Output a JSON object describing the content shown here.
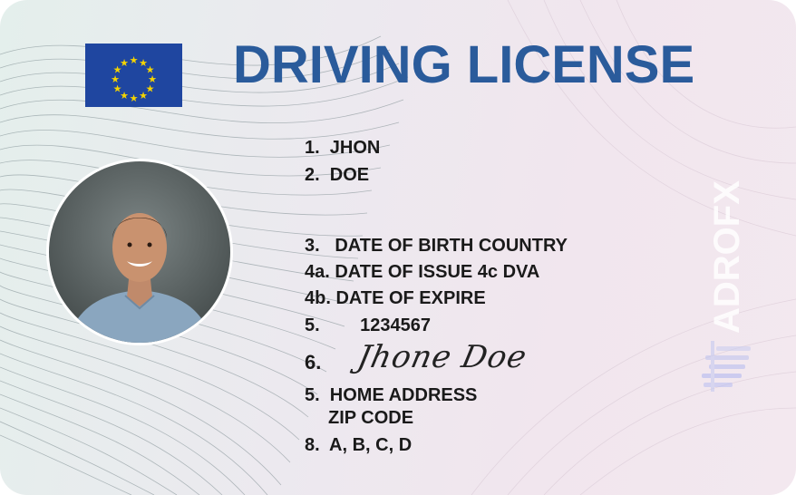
{
  "card": {
    "title": "DRIVING LICENSE",
    "flag_icon": "eu-flag-icon",
    "photo_icon": "portrait-photo-icon"
  },
  "fields": {
    "f1": "1.  JHON",
    "f2": "2.  DOE",
    "f3": "3.   DATE OF BIRTH COUNTRY",
    "f4a": "4a. DATE OF ISSUE 4c DVA",
    "f4b": "4b. DATE OF EXPIRE",
    "f5_number": "5.        1234567",
    "f6_label": "6.",
    "signature": "Jhone Doe",
    "f5_address": "5.  HOME ADDRESS",
    "zip": "ZIP CODE",
    "f8": "8.  A, B, C, D"
  },
  "watermark": {
    "text": "ADROFX",
    "icon": "adrofx-logo-icon"
  },
  "colors": {
    "title": "#2a5b9b",
    "flag": "#1f46a0",
    "stars": "#f5d400",
    "text": "#1a1a1a"
  }
}
